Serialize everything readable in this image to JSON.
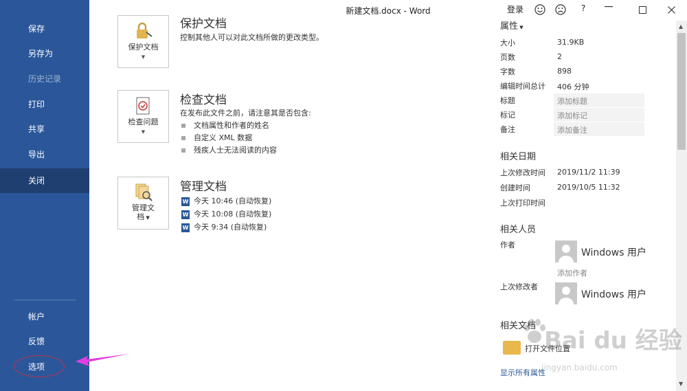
{
  "window": {
    "title": "新建文档.docx  -  Word",
    "login_label": "登录",
    "help_label": "?"
  },
  "sidebar": {
    "items": [
      {
        "label": "保存"
      },
      {
        "label": "另存为"
      },
      {
        "label": "历史记录"
      },
      {
        "label": "打印"
      },
      {
        "label": "共享"
      },
      {
        "label": "导出"
      },
      {
        "label": "关闭"
      }
    ],
    "bottom_items": [
      {
        "label": "帐户"
      },
      {
        "label": "反馈"
      },
      {
        "label": "选项"
      }
    ],
    "active_item": "关闭"
  },
  "main": {
    "protect": {
      "title": "保护文档",
      "desc": "控制其他人可以对此文档所做的更改类型。",
      "button_label": "保护文档"
    },
    "inspect": {
      "title": "检查文档",
      "desc": "在发布此文件之前，请注意其是否包含:",
      "bullets": [
        "文档属性和作者的姓名",
        "自定义 XML 数据",
        "残疾人士无法阅读的内容"
      ],
      "button_label": "检查问题"
    },
    "manage": {
      "title": "管理文档",
      "button_label_1": "管理文",
      "button_label_2": "档",
      "versions": [
        "今天 10:46 (自动恢复)",
        "今天 10:08 (自动恢复)",
        "今天 9:34 (自动恢复)"
      ]
    }
  },
  "properties": {
    "heading": "属性",
    "rows": [
      {
        "label": "大小",
        "value": "31.9KB"
      },
      {
        "label": "页数",
        "value": "2"
      },
      {
        "label": "字数",
        "value": "898"
      },
      {
        "label": "编辑时间总计",
        "value": "406 分钟"
      },
      {
        "label": "标题",
        "value": "添加标题"
      },
      {
        "label": "标记",
        "value": "添加标记"
      },
      {
        "label": "备注",
        "value": "添加备注"
      }
    ],
    "dates_heading": "相关日期",
    "dates": [
      {
        "label": "上次修改时间",
        "value": "2019/11/2 11:39"
      },
      {
        "label": "创建时间",
        "value": "2019/10/5 11:32"
      },
      {
        "label": "上次打印时间",
        "value": ""
      }
    ],
    "people_heading": "相关人员",
    "author_label": "作者",
    "author_name": "Windows 用户",
    "add_author": "添加作者",
    "modifier_label": "上次修改者",
    "modifier_name": "Windows 用户",
    "docs_heading": "相关文档",
    "open_location": "打开文件位置",
    "show_all": "显示所有属性"
  },
  "watermark": {
    "text": "Bai du 经验",
    "url": "jingyan.baidu.com"
  },
  "colors": {
    "sidebar": "#2b579a",
    "sidebar_active": "#1e3f70",
    "annotation": "#e040e0",
    "ellipse": "#c0304a"
  }
}
